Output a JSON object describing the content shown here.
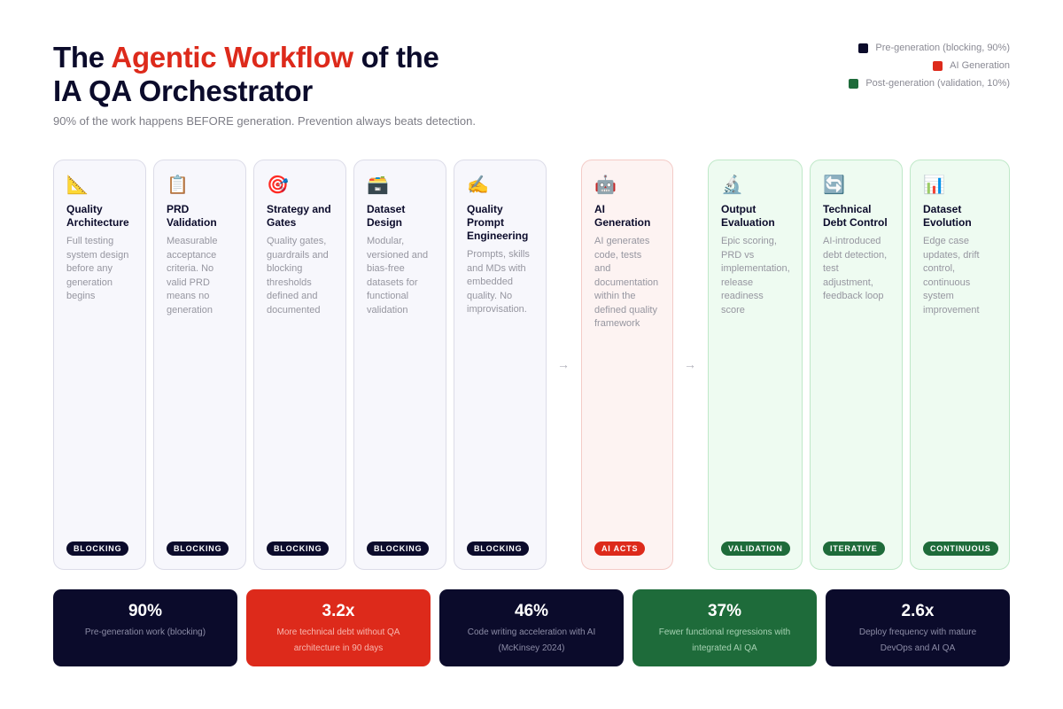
{
  "header": {
    "title_part1": "The ",
    "title_accent": "Agentic Workflow",
    "title_part2": " of the",
    "title_line2": "IA QA Orchestrator",
    "subtitle": "90% of the work happens BEFORE generation. Prevention always beats detection."
  },
  "legend": [
    {
      "label": "Pre-generation (blocking, 90%)",
      "color": "#0b0b2b"
    },
    {
      "label": "AI Generation",
      "color": "#dd2a1b"
    },
    {
      "label": "Post-generation (validation, 10%)",
      "color": "#1e6b3a"
    }
  ],
  "colors": {
    "navy": "#0b0b2b",
    "red": "#dd2a1b",
    "green": "#1e6b3a"
  },
  "arrows": [
    "→",
    "→"
  ],
  "cards": [
    {
      "icon": "📐",
      "icon_name": "triangle-ruler-icon",
      "title": "Quality Architecture",
      "desc": "Full testing system design before any generation begins",
      "badge": "BLOCKING"
    },
    {
      "icon": "📋",
      "icon_name": "clipboard-icon",
      "title": "PRD Validation",
      "desc": "Measurable acceptance criteria. No valid PRD means no generation",
      "badge": "BLOCKING"
    },
    {
      "icon": "🎯",
      "icon_name": "target-icon",
      "title": "Strategy and Gates",
      "desc": "Quality gates, guardrails and blocking thresholds defined and documented",
      "badge": "BLOCKING"
    },
    {
      "icon": "🗃️",
      "icon_name": "card-file-box-icon",
      "title": "Dataset Design",
      "desc": "Modular, versioned and bias-free datasets for functional validation",
      "badge": "BLOCKING"
    },
    {
      "icon": "✍️",
      "icon_name": "writing-hand-icon",
      "title": "Quality Prompt Engineering",
      "desc": "Prompts, skills and MDs with embedded quality. No improvisation.",
      "badge": "BLOCKING"
    },
    {
      "icon": "🤖",
      "icon_name": "robot-icon",
      "title": "AI Generation",
      "desc": "AI generates code, tests and documentation within the defined quality framework",
      "badge": "AI ACTS"
    },
    {
      "icon": "🔬",
      "icon_name": "microscope-icon",
      "title": "Output Evaluation",
      "desc": "Epic scoring, PRD vs implementation, release readiness score",
      "badge": "VALIDATION"
    },
    {
      "icon": "🔄",
      "icon_name": "refresh-arrows-icon",
      "title": "Technical Debt Control",
      "desc": "AI-introduced debt detection, test adjustment, feedback loop",
      "badge": "ITERATIVE"
    },
    {
      "icon": "📊",
      "icon_name": "bar-chart-icon",
      "title": "Dataset Evolution",
      "desc": "Edge case updates, drift control, continuous system improvement",
      "badge": "CONTINUOUS"
    }
  ],
  "stats": [
    {
      "value": "90%",
      "label": "Pre-generation work (blocking)"
    },
    {
      "value": "3.2x",
      "label": "More technical debt without QA architecture in 90 days"
    },
    {
      "value": "46%",
      "label": "Code writing acceleration with AI (McKinsey 2024)"
    },
    {
      "value": "37%",
      "label": "Fewer functional regressions with integrated AI QA"
    },
    {
      "value": "2.6x",
      "label": "Deploy frequency with mature DevOps and AI QA"
    }
  ]
}
